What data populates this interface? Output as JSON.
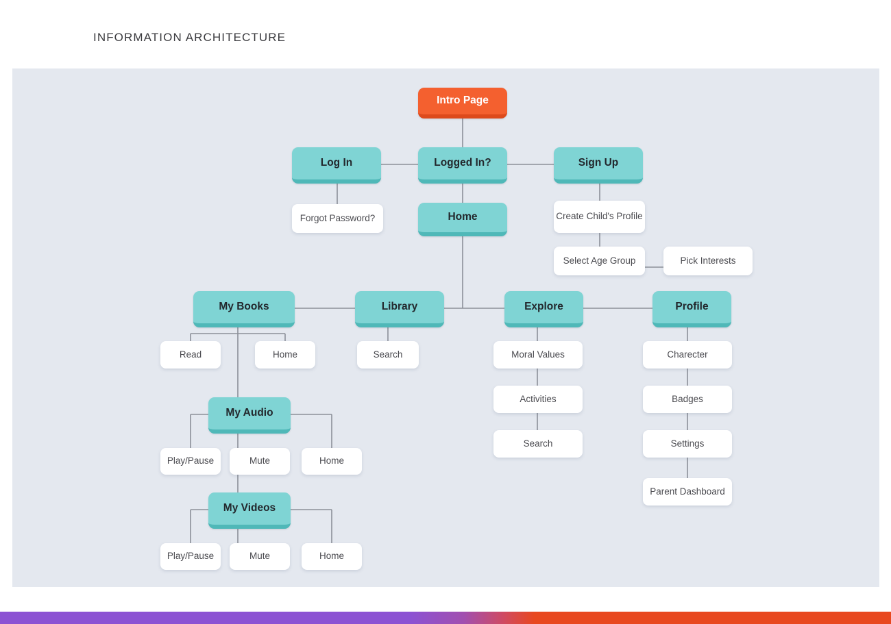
{
  "page": {
    "title": "INFORMATION ARCHITECTURE",
    "canvas_background": "#e4e8ef",
    "accent_teal": "#7fd4d4",
    "accent_orange": "#f4602f",
    "footer_gradient_from": "#8c52d3",
    "footer_gradient_to": "#e8481f"
  },
  "nodes": {
    "intro_page": "Intro Page",
    "log_in": "Log In",
    "logged_in": "Logged In?",
    "sign_up": "Sign Up",
    "forgot_password": "Forgot Password?",
    "home": "Home",
    "create_child_profile": "Create Child's Profile",
    "select_age_group": "Select Age Group",
    "pick_interests": "Pick Interests",
    "my_books": "My Books",
    "library": "Library",
    "explore": "Explore",
    "profile": "Profile",
    "books_read": "Read",
    "books_home": "Home",
    "library_search": "Search",
    "moral_values": "Moral Values",
    "activities": "Activities",
    "explore_search": "Search",
    "charecter": "Charecter",
    "badges": "Badges",
    "settings": "Settings",
    "parent_dashboard": "Parent Dashboard",
    "my_audio": "My Audio",
    "audio_play_pause": "Play/Pause",
    "audio_mute": "Mute",
    "audio_home": "Home",
    "my_videos": "My Videos",
    "video_play_pause": "Play/Pause",
    "video_mute": "Mute",
    "video_home": "Home"
  }
}
